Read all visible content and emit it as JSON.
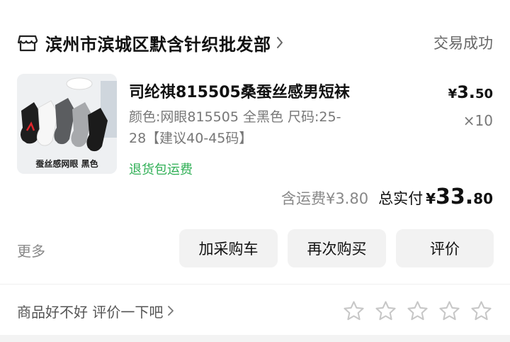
{
  "shop": {
    "name": "滨州市滨城区默含针织批发部",
    "icon": "store-icon",
    "status": "交易成功"
  },
  "product": {
    "title": "司纶祺815505桑蚕丝感男短袜",
    "spec": "颜色:网眼815505 全黑色 尺码:25-28【建议40-45码】",
    "image_caption": "蚕丝感网眼 黑色",
    "price_currency": "¥",
    "price_int": "3.",
    "price_dec": "50",
    "quantity": "×10",
    "return_tag": "退货包运费"
  },
  "totals": {
    "shipping": "含运费¥3.80",
    "label": "总实付",
    "currency": "¥",
    "amount_int": "33.",
    "amount_dec": "80"
  },
  "actions": {
    "more": "更多",
    "add_to_cart": "加采购车",
    "buy_again": "再次购买",
    "review": "评价"
  },
  "rating": {
    "prompt": "商品好不好 评价一下吧",
    "stars": 5,
    "selected": 0
  },
  "colors": {
    "green_tag": "#2faf55",
    "button_bg": "#f2f2f2",
    "muted_text": "#777777"
  }
}
